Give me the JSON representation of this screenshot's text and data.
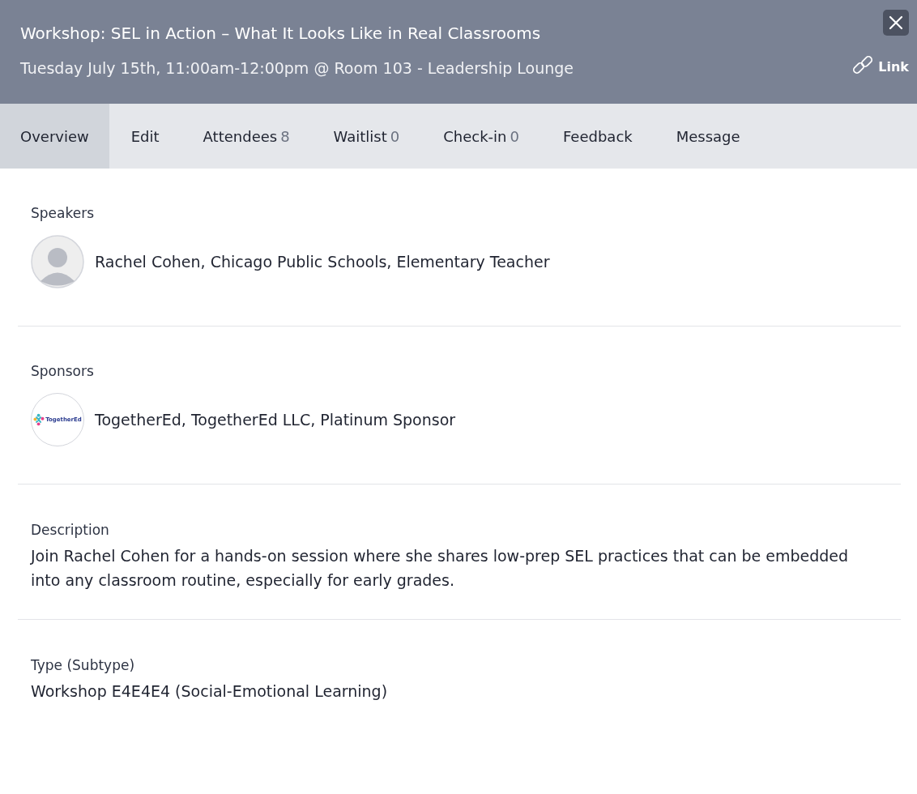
{
  "header": {
    "title": "Workshop: SEL in Action – What It Looks Like in Real Classrooms",
    "subtitle": "Tuesday July 15th, 11:00am-12:00pm @ Room 103 - Leadership Lounge",
    "link_label": "Link"
  },
  "tabs": [
    {
      "label": "Overview",
      "selected": true
    },
    {
      "label": "Edit",
      "selected": false
    },
    {
      "label": "Attendees",
      "count": "8",
      "selected": false
    },
    {
      "label": "Waitlist",
      "count": "0",
      "selected": false
    },
    {
      "label": "Check-in",
      "count": "0",
      "selected": false
    },
    {
      "label": "Feedback",
      "selected": false
    },
    {
      "label": "Message",
      "selected": false
    }
  ],
  "sections": [
    {
      "kind": "people",
      "heading": "Speakers",
      "entries": [
        {
          "kind": "photo",
          "text": "Rachel Cohen, Chicago Public Schools, Elementary Teacher"
        }
      ]
    },
    {
      "kind": "people",
      "heading": "Sponsors",
      "entries": [
        {
          "kind": "logo",
          "logo_text": "TogetherEd",
          "text": "TogetherEd, TogetherEd LLC, Platinum Sponsor"
        }
      ]
    },
    {
      "kind": "text",
      "heading": "Description",
      "body": "Join Rachel Cohen for a hands-on session where she shares low-prep SEL practices that can be embedded into any classroom routine, especially for early grades."
    },
    {
      "kind": "text",
      "heading": "Type (Subtype)",
      "body": "Workshop E4E4E4 (Social-Emotional Learning)"
    }
  ]
}
